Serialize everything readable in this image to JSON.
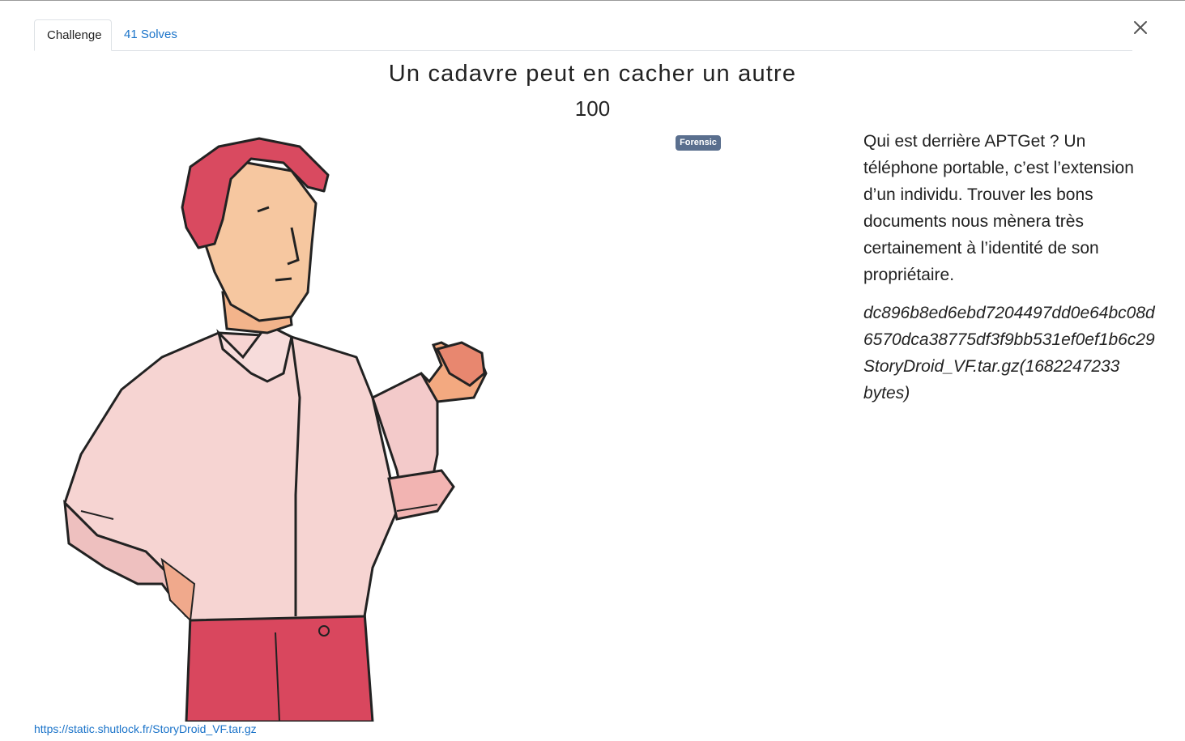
{
  "tabs": [
    {
      "label": "Challenge",
      "active": true
    },
    {
      "label": "41 Solves",
      "active": false
    }
  ],
  "challenge": {
    "title": "Un cadavre peut en cacher un autre",
    "points": "100",
    "category_badge": "Forensic",
    "description": "Qui est derrière APTGet ? Un téléphone portable, c’est l’extension d’un individu. Trouver les bons documents nous mènera très certainement à l’identité de son propriétaire.",
    "hash": "dc896b8ed6ebd7204497dd0e64bc08d6570dca38775df3f9bb531ef0ef1b6c29",
    "file_info": "StoryDroid_VF.tar.gz(1682247233 bytes)",
    "file_link": "https://static.shutlock.fr/StoryDroid_VF.tar.gz"
  },
  "icons": {
    "close": "close-icon"
  },
  "colors": {
    "link": "#1a73c9",
    "badge": "#5a6f8e"
  }
}
